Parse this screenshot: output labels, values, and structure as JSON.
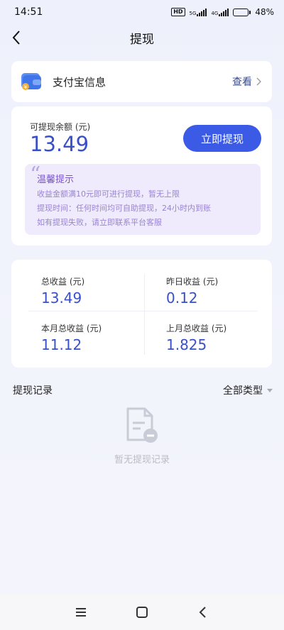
{
  "status_bar": {
    "time": "14:51",
    "hd": "HD",
    "net1": "5G",
    "net2": "4G",
    "battery_level": 0.48,
    "battery_text": "48%"
  },
  "nav": {
    "title": "提现",
    "back_icon": "chevron-left-icon"
  },
  "alipay": {
    "label": "支付宝信息",
    "view_label": "查看",
    "icon": "wallet-icon"
  },
  "balance": {
    "label": "可提现余额 (元)",
    "value": "13.49",
    "withdraw_button": "立即提现"
  },
  "tips": {
    "title": "温馨提示",
    "lines": [
      "收益金额满10元即可进行提现，暂无上限",
      "提现时间：任何时间均可自助提现，24小时内到账",
      "如有提现失败，请立即联系平台客服"
    ]
  },
  "stats": [
    {
      "label": "总收益 (元)",
      "value": "13.49"
    },
    {
      "label": "昨日收益 (元)",
      "value": "0.12"
    },
    {
      "label": "本月总收益 (元)",
      "value": "11.12"
    },
    {
      "label": "上月总收益 (元)",
      "value": "1.825"
    }
  ],
  "records": {
    "title": "提现记录",
    "filter_label": "全部类型",
    "empty_text": "暂无提现记录"
  },
  "colors": {
    "accent": "#3b5ae6",
    "value_blue": "#3950c8",
    "tip_bg": "#efeafc",
    "tip_title": "#7a55c9",
    "tip_text": "#9a84d4"
  }
}
